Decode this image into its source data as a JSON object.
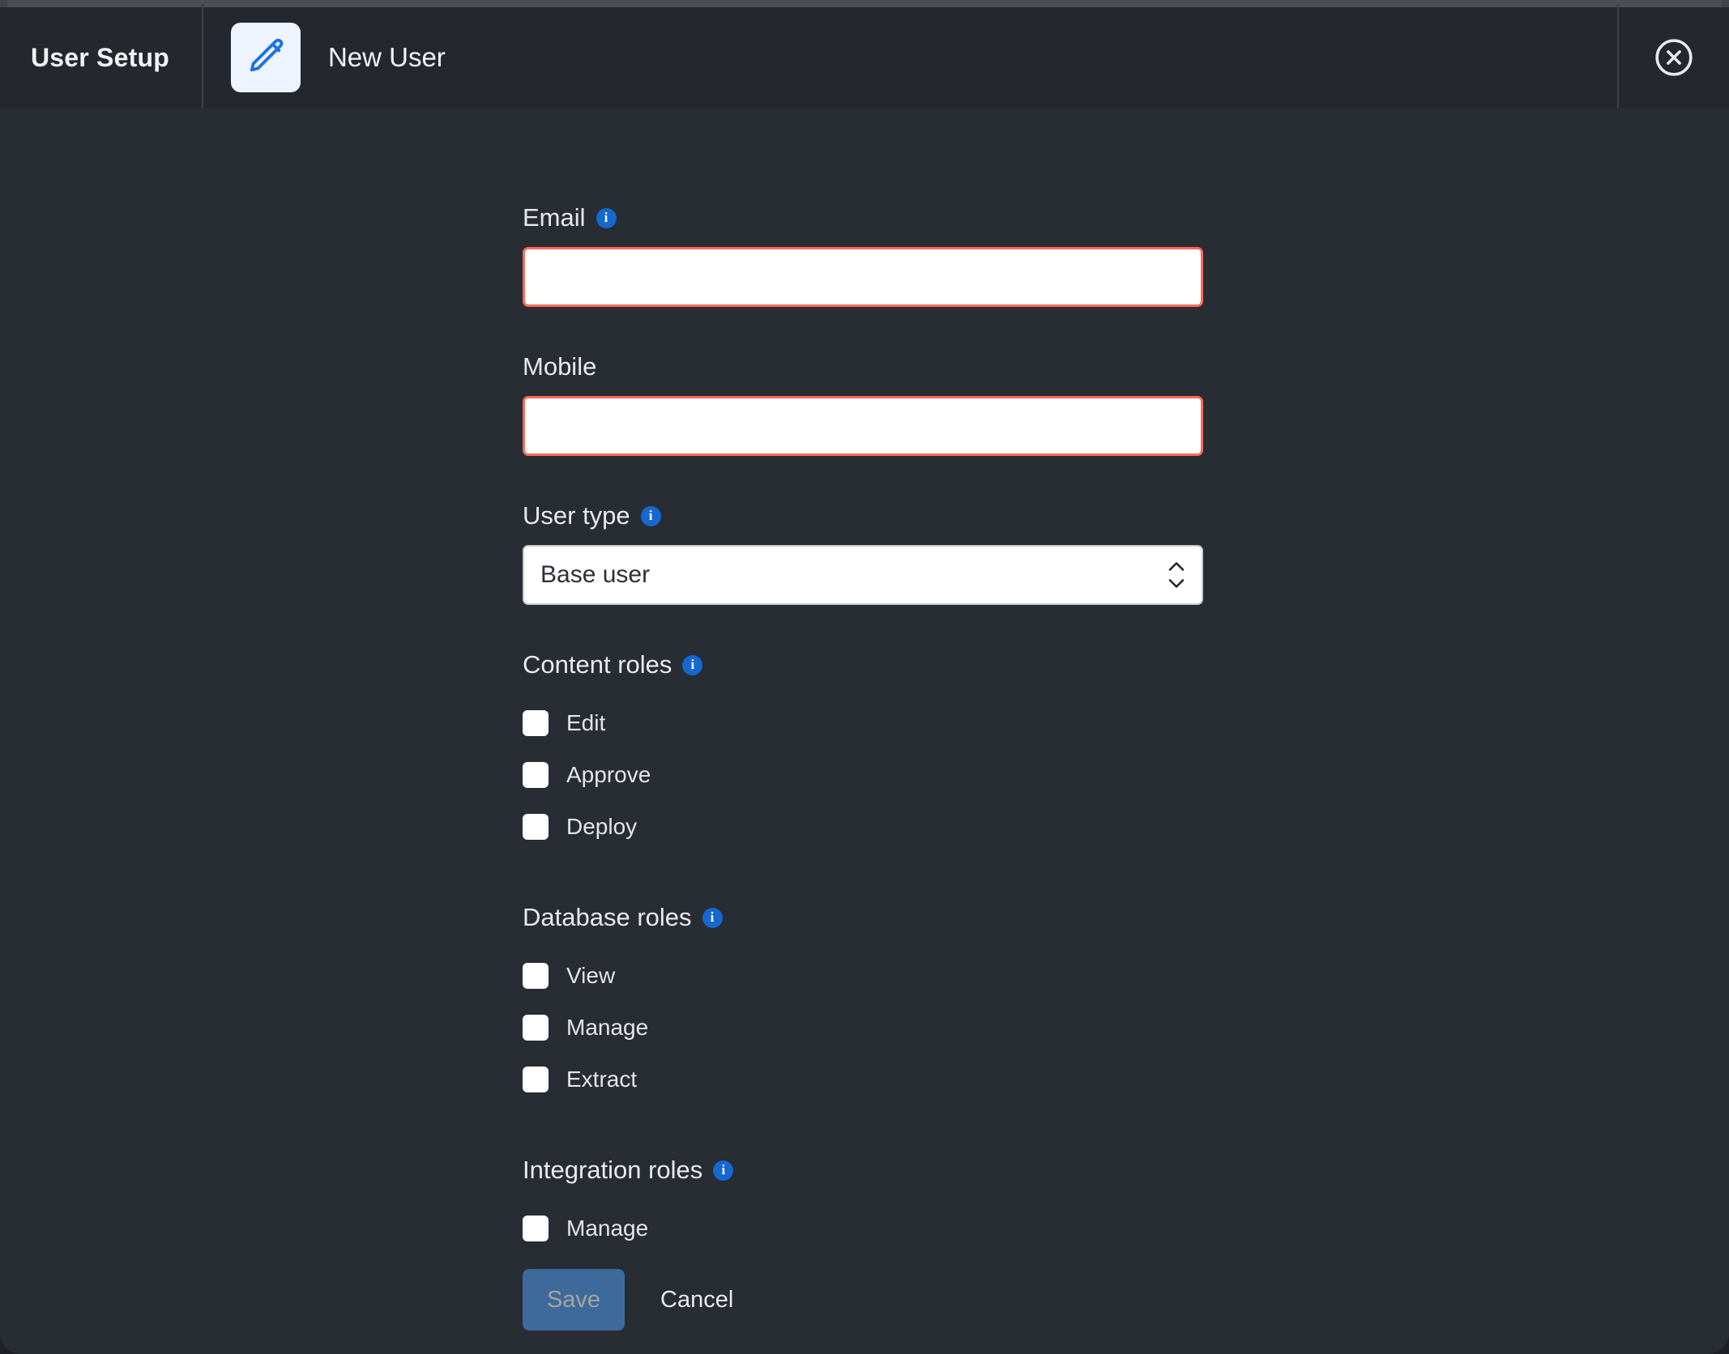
{
  "window": {
    "frame_color": "#4a4f57",
    "background": "#282c33",
    "header_background": "#24282e"
  },
  "header": {
    "breadcrumb_root": "User Setup",
    "edit_icon": "pencil-icon",
    "title": "New User",
    "close_icon": "close-circle-icon",
    "accent_blue": "#1a73e8"
  },
  "form": {
    "email": {
      "label": "Email",
      "info_icon": "info-icon",
      "has_info": true,
      "value": "",
      "placeholder": "",
      "invalid": true,
      "border_color": "#fa6a5a"
    },
    "mobile": {
      "label": "Mobile",
      "has_info": false,
      "value": "",
      "placeholder": "",
      "invalid": true,
      "border_color": "#fa6a5a"
    },
    "user_type": {
      "label": "User type",
      "has_info": true,
      "selected": "Base user",
      "stepper_icon": "chevron-up-down-icon"
    },
    "content_roles": {
      "title": "Content roles",
      "has_info": true,
      "items": [
        {
          "label": "Edit",
          "checked": false
        },
        {
          "label": "Approve",
          "checked": false
        },
        {
          "label": "Deploy",
          "checked": false
        }
      ]
    },
    "database_roles": {
      "title": "Database roles",
      "has_info": true,
      "items": [
        {
          "label": "View",
          "checked": false
        },
        {
          "label": "Manage",
          "checked": false
        },
        {
          "label": "Extract",
          "checked": false
        }
      ]
    },
    "integration_roles": {
      "title": "Integration roles",
      "has_info": true,
      "items": [
        {
          "label": "Manage",
          "checked": false
        }
      ]
    },
    "actions": {
      "save_label": "Save",
      "save_disabled": true,
      "save_color": "#3d6a9b",
      "cancel_label": "Cancel"
    }
  }
}
